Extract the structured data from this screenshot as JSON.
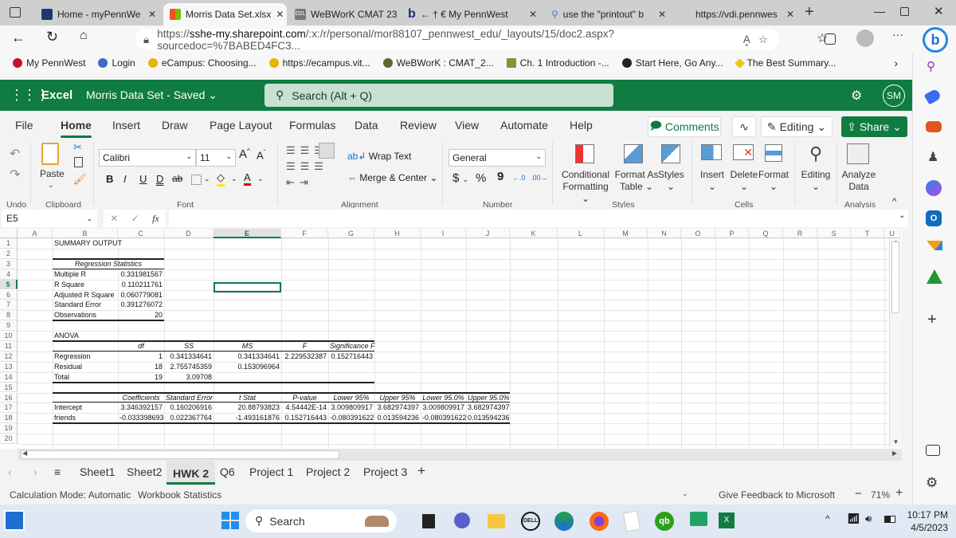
{
  "browser": {
    "tabs": [
      {
        "label": "Home - myPennWe",
        "icon": "pennwest-icon",
        "active": false
      },
      {
        "label": "Morris Data Set.xlsx",
        "icon": "microsoft-icon",
        "active": true
      },
      {
        "label": "WeBWorK CMAT 23",
        "icon": "d2l-icon",
        "active": false
      },
      {
        "label": "← † € My PennWest",
        "icon": "bing-b-icon",
        "active": false
      },
      {
        "label": "use the \"printout\" b",
        "icon": "search-icon",
        "active": false
      },
      {
        "label": "https://vdi.pennwes",
        "icon": "blank-icon",
        "active": false
      }
    ],
    "new_tab": "+",
    "url_prefix": "https://",
    "url_domain": "sshe-my.sharepoint.com",
    "url_rest": "/:x:/r/personal/mor88107_pennwest_edu/_layouts/15/doc2.aspx?sourcedoc=%7BABED4FC3...",
    "read_aloud": "A͓",
    "more": "···",
    "bookmarks": [
      {
        "label": "My PennWest",
        "color": "#c8102e"
      },
      {
        "label": "Login",
        "color": "#3b6cc4"
      },
      {
        "label": "eCampus: Choosing...",
        "color": "#e8b400"
      },
      {
        "label": "https://ecampus.vit...",
        "color": "#e8b400"
      },
      {
        "label": "WeBWorK : CMAT_2...",
        "color": "#556b2f"
      },
      {
        "label": "Ch. 1 Introduction -...",
        "color": "#7a9a3a"
      },
      {
        "label": "Start Here, Go Any...",
        "color": "#222222"
      },
      {
        "label": "The Best Summary...",
        "color": "#f0c419"
      }
    ]
  },
  "excel": {
    "app_name": "Excel",
    "doc_title": "Morris Data Set",
    "save_status": "Saved",
    "search_placeholder": "Search (Alt + Q)",
    "avatar": "SM",
    "brand_color": "#107c41",
    "ribbon_tabs": [
      "File",
      "Home",
      "Insert",
      "Draw",
      "Page Layout",
      "Formulas",
      "Data",
      "Review",
      "View",
      "Automate",
      "Help"
    ],
    "active_tab": "Home",
    "comments_label": "Comments",
    "editing_label": "Editing",
    "share_label": "Share",
    "ribbon": {
      "undo_group": "Undo",
      "clipboard_group": "Clipboard",
      "paste": "Paste",
      "font_name": "Calibri",
      "font_size": "11",
      "font_group": "Font",
      "bold": "B",
      "italic": "I",
      "underline": "U",
      "double_underline": "D",
      "strike": "ab",
      "wrap_text": "Wrap Text",
      "merge_center": "Merge & Center",
      "alignment_group": "Alignment",
      "number_format": "General",
      "number_group": "Number",
      "currency": "$",
      "percent": "%",
      "comma": "9",
      "conditional_formatting": [
        "Conditional",
        "Formatting"
      ],
      "format_as_table": [
        "Format As",
        "Table"
      ],
      "styles": "Styles",
      "styles_group": "Styles",
      "insert": "Insert",
      "delete": "Delete",
      "format": "Format",
      "cells_group": "Cells",
      "editing": "Editing",
      "analyze_data": [
        "Analyze",
        "Data"
      ],
      "analysis_group": "Analysis"
    },
    "name_box": "E5",
    "fx": "fx",
    "formula": "",
    "columns": [
      "A",
      "B",
      "C",
      "D",
      "E",
      "F",
      "G",
      "H",
      "I",
      "J",
      "K",
      "L",
      "M",
      "N",
      "O",
      "P",
      "Q",
      "R",
      "S",
      "T",
      "U"
    ],
    "rows": [
      "1",
      "2",
      "3",
      "4",
      "5",
      "6",
      "7",
      "8",
      "9",
      "10",
      "11",
      "12",
      "13",
      "14",
      "15",
      "16",
      "17",
      "18",
      "19",
      "20"
    ],
    "selected_cell": "E5",
    "summary": {
      "title": "SUMMARY OUTPUT",
      "reg_stats_header": "Regression Statistics",
      "reg_stats": [
        {
          "label": "Multiple R",
          "value": "0.331981567"
        },
        {
          "label": "R Square",
          "value": "0.110211761"
        },
        {
          "label": "Adjusted R Square",
          "value": "0.060779081"
        },
        {
          "label": "Standard Error",
          "value": "0.391276072"
        },
        {
          "label": "Observations",
          "value": "20"
        }
      ],
      "anova_title": "ANOVA",
      "anova_headers": [
        "",
        "df",
        "SS",
        "MS",
        "F",
        "Significance F"
      ],
      "anova_rows": [
        [
          "Regression",
          "1",
          "0.341334641",
          "0.341334641",
          "2.229532387",
          "0.152716443"
        ],
        [
          "Residual",
          "18",
          "2.755745359",
          "0.153096964",
          "",
          ""
        ],
        [
          "Total",
          "19",
          "3.09708",
          "",
          "",
          ""
        ]
      ],
      "coef_headers": [
        "",
        "Coefficients",
        "Standard Error",
        "t Stat",
        "P-value",
        "Lower 95%",
        "Upper 95%",
        "Lower 95.0%",
        "Upper 95.0%"
      ],
      "coef_rows": [
        [
          "Intercept",
          "3.346392157",
          "0.160206916",
          "20.88793823",
          "4.54442E-14",
          "3.009809917",
          "3.682974397",
          "3.009809917",
          "3.682974397"
        ],
        [
          "friends",
          "-0.033398693",
          "0.022367764",
          "-1.493161876",
          "0.152716443",
          "-0.080391622",
          "0.013594236",
          "-0.080391622",
          "0.013594236"
        ]
      ]
    },
    "sheets": [
      "Sheet1",
      "Sheet2",
      "HWK 2",
      "Q6",
      "Project 1",
      "Project 2",
      "Project 3"
    ],
    "active_sheet": "HWK 2",
    "add_sheet": "+",
    "status": {
      "calc_mode": "Calculation Mode: Automatic",
      "workbook_stats": "Workbook Statistics",
      "feedback": "Give Feedback to Microsoft",
      "zoom": "71%"
    }
  },
  "taskbar": {
    "search": "Search",
    "time": "10:17 PM",
    "date": "4/5/2023"
  }
}
